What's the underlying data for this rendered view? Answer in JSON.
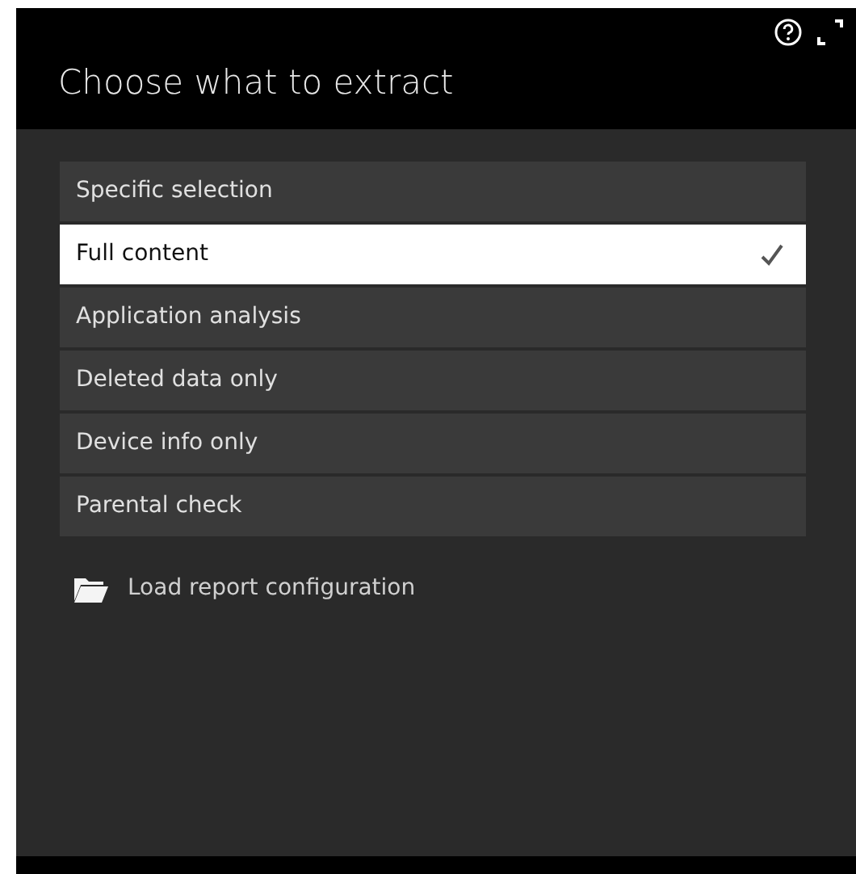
{
  "header": {
    "title": "Choose what to extract"
  },
  "options": [
    {
      "label": "Specific selection",
      "selected": false
    },
    {
      "label": "Full content",
      "selected": true
    },
    {
      "label": "Application analysis",
      "selected": false
    },
    {
      "label": "Deleted data only",
      "selected": false
    },
    {
      "label": "Device info only",
      "selected": false
    },
    {
      "label": "Parental check",
      "selected": false
    }
  ],
  "load_link": {
    "label": "Load report configuration"
  }
}
